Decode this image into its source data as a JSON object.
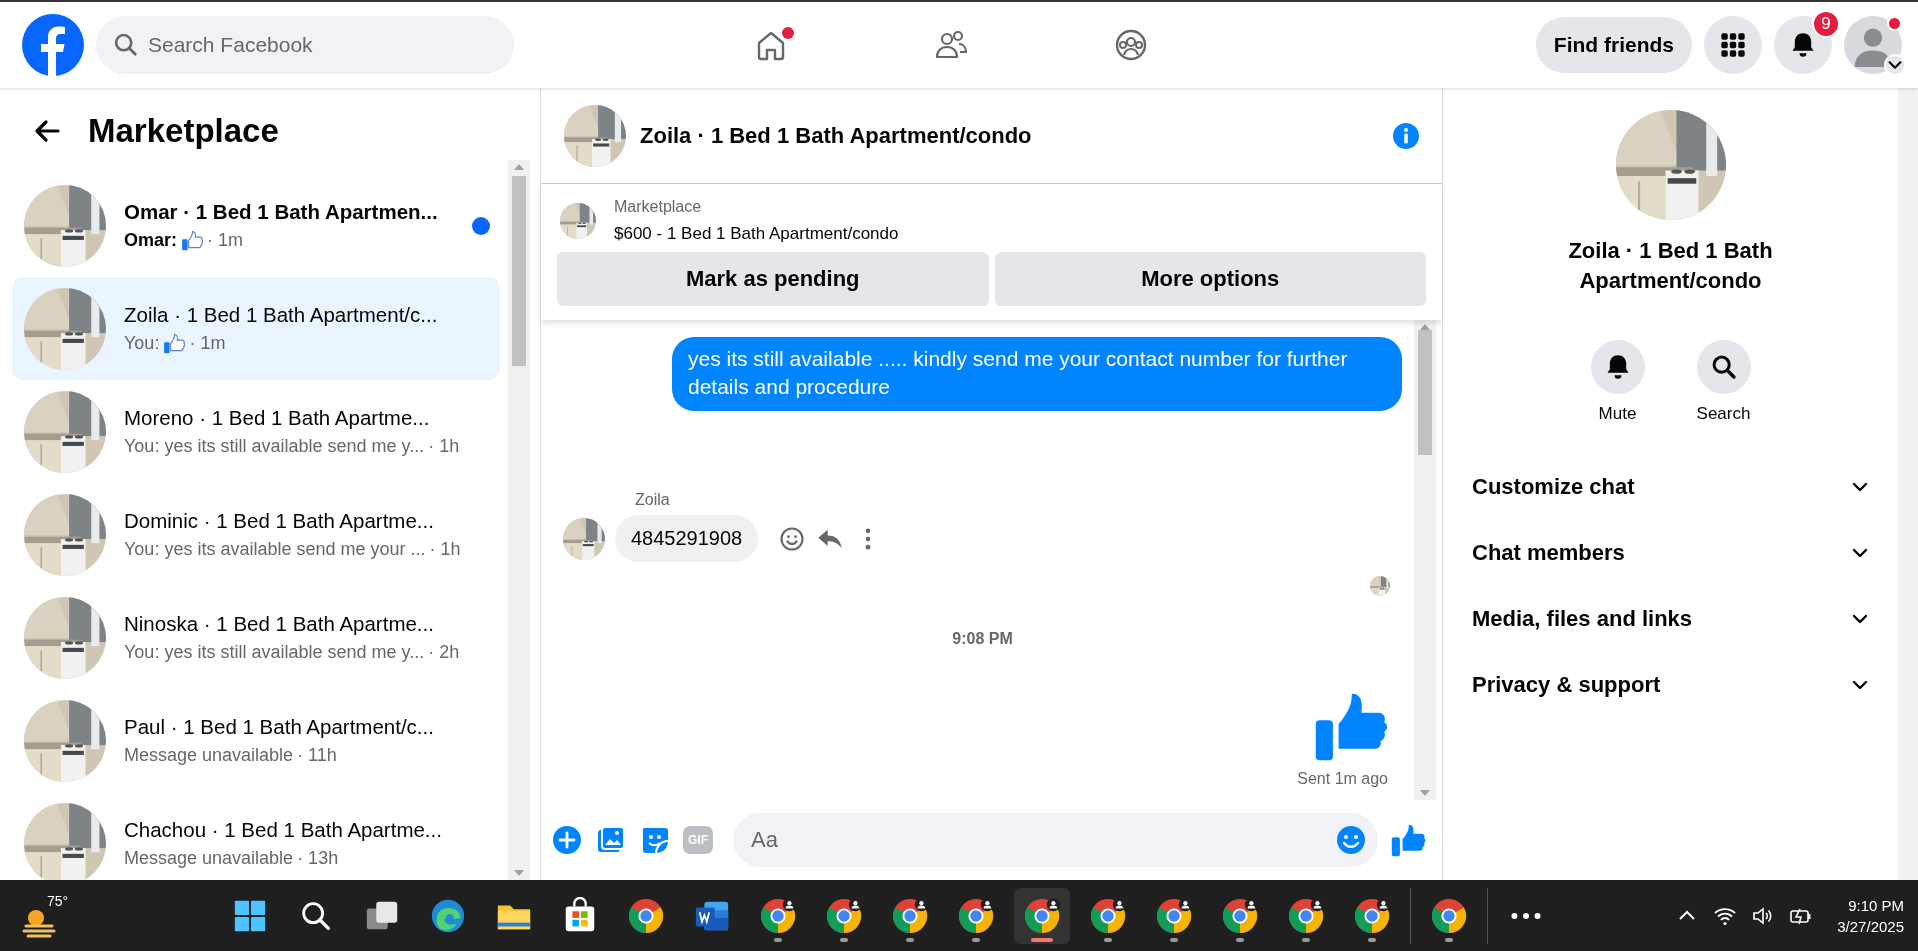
{
  "top_bar": {
    "search": {
      "placeholder": "Search Facebook"
    },
    "nav": [
      {
        "kind": "home",
        "selected": false,
        "dot": true
      },
      {
        "kind": "friends",
        "selected": false,
        "dot": false
      },
      {
        "kind": "groups",
        "selected": false,
        "dot": false
      }
    ],
    "find_friends": "Find friends",
    "notifications_badge": "9",
    "profile_dot": true
  },
  "sidebar": {
    "title": "Marketplace",
    "conversations": [
      {
        "name": "Omar · 1 Bed 1 Bath Apartmen...",
        "prefix": "Omar:",
        "like": true,
        "time": "· 1m",
        "unread": true,
        "selected": false
      },
      {
        "name": "Zoila · 1 Bed 1 Bath Apartment/c...",
        "prefix": "You:",
        "like": true,
        "time": "· 1m",
        "unread": false,
        "selected": true
      },
      {
        "name": "Moreno · 1 Bed 1 Bath Apartme...",
        "like": false,
        "snippet": "You: yes its still available send me y...",
        "time": "· 1h",
        "unread": false,
        "selected": false
      },
      {
        "name": "Dominic · 1 Bed 1 Bath Apartme...",
        "like": false,
        "snippet": "You: yes its available send me your ...",
        "time": "· 1h",
        "unread": false,
        "selected": false
      },
      {
        "name": "Ninoska · 1 Bed 1 Bath Apartme...",
        "like": false,
        "snippet": "You: yes its still available send me y...",
        "time": "· 2h",
        "unread": false,
        "selected": false
      },
      {
        "name": "Paul · 1 Bed 1 Bath Apartment/c...",
        "like": false,
        "snippet": "Message unavailable",
        "time": "· 11h",
        "unread": false,
        "selected": false
      },
      {
        "name": "Chachou · 1 Bed 1 Bath Apartme...",
        "like": false,
        "snippet": "Message unavailable",
        "time": "· 13h",
        "unread": false,
        "selected": false
      }
    ]
  },
  "chat": {
    "title": "Zoila · 1 Bed 1 Bath Apartment/condo",
    "listing": {
      "label": "Marketplace",
      "title": "$600 - 1 Bed 1 Bath Apartment/condo",
      "buttons": [
        "Mark as pending",
        "More options"
      ]
    },
    "messages": [
      {
        "kind": "outgoing",
        "text": "yes its still available ..... kindly send me your contact number for further details and procedure"
      },
      {
        "kind": "incoming",
        "sender": "Zoila",
        "text": "4845291908"
      },
      {
        "kind": "receipt"
      },
      {
        "kind": "timestamp",
        "text": "9:08 PM"
      },
      {
        "kind": "like",
        "status": "Sent 1m ago"
      }
    ],
    "composer": {
      "gif": "GIF",
      "placeholder": "Aa"
    }
  },
  "details": {
    "title": "Zoila · 1 Bed 1 Bath Apartment/condo",
    "actions": [
      {
        "kind": "mute",
        "label": "Mute"
      },
      {
        "kind": "search",
        "label": "Search"
      }
    ],
    "sections": [
      {
        "label": "Customize chat",
        "expanded": false
      },
      {
        "label": "Chat members",
        "expanded": false
      },
      {
        "label": "Media, files and links",
        "expanded": false
      },
      {
        "label": "Privacy & support",
        "expanded": false
      }
    ]
  },
  "taskbar": {
    "weather": "75°",
    "apps": [
      {
        "kind": "start",
        "running": false,
        "active": false
      },
      {
        "kind": "search",
        "running": false,
        "active": false
      },
      {
        "kind": "taskview",
        "running": false,
        "active": false
      },
      {
        "kind": "edge",
        "running": false,
        "active": false
      },
      {
        "kind": "files",
        "running": false,
        "active": false
      },
      {
        "kind": "store",
        "running": false,
        "active": false
      },
      {
        "kind": "chrome",
        "running": false,
        "active": false
      },
      {
        "kind": "word",
        "running": false,
        "active": false
      },
      {
        "kind": "chrome-profile",
        "running": true,
        "active": false
      },
      {
        "kind": "chrome-profile",
        "running": true,
        "active": false
      },
      {
        "kind": "chrome-profile",
        "running": true,
        "active": false
      },
      {
        "kind": "chrome-profile",
        "running": true,
        "active": false
      },
      {
        "kind": "chrome-profile",
        "running": true,
        "active": true
      },
      {
        "kind": "chrome-profile",
        "running": true,
        "active": false
      },
      {
        "kind": "chrome-profile",
        "running": true,
        "active": false
      },
      {
        "kind": "chrome-profile",
        "running": true,
        "active": false
      },
      {
        "kind": "chrome-profile",
        "running": true,
        "active": false
      },
      {
        "kind": "chrome-profile",
        "running": true,
        "active": false
      },
      {
        "kind": "chrome",
        "running": true,
        "active": false
      },
      {
        "kind": "more",
        "running": false,
        "active": false
      }
    ],
    "time": "9:10 PM",
    "date": "3/27/2025"
  }
}
